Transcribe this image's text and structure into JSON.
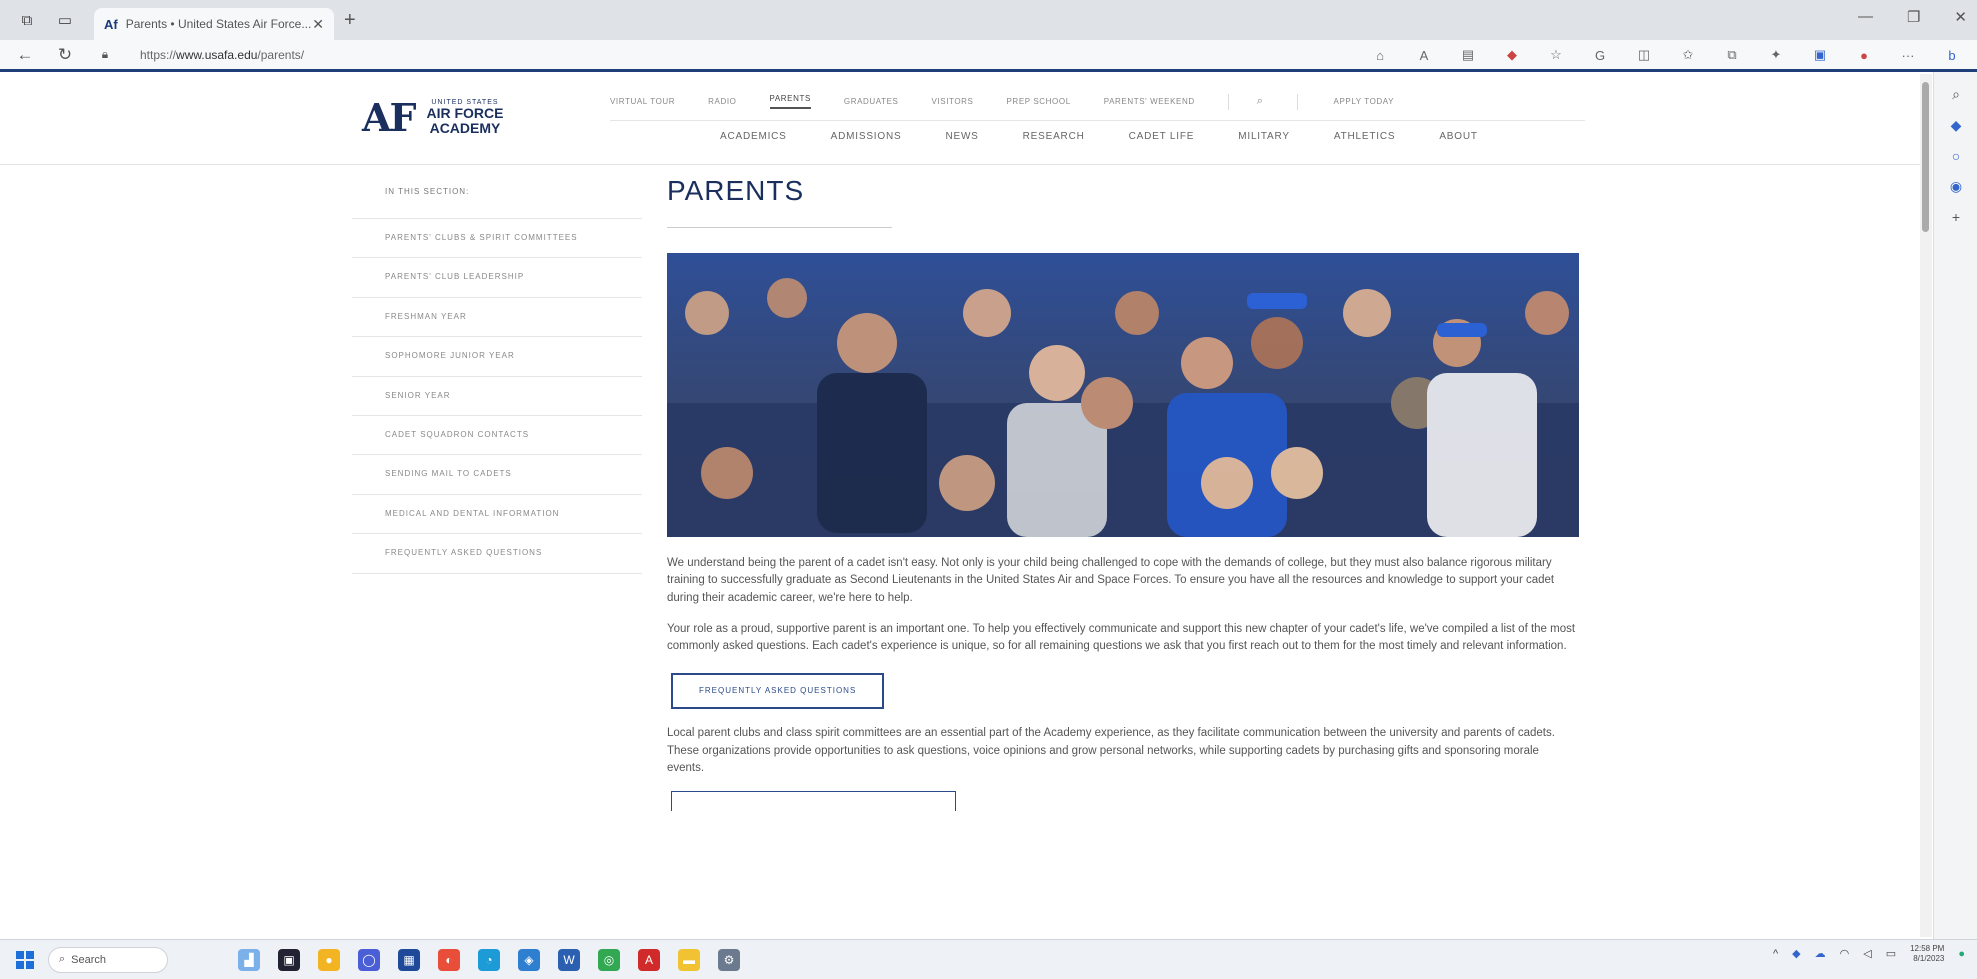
{
  "browser": {
    "tab_title": "Parents • United States Air Force...",
    "tab_favicon": "Af",
    "url_prefix": "https://",
    "url_domain": "www.usafa.edu",
    "url_path": "/parents/"
  },
  "site": {
    "logo": {
      "mark": "AF",
      "line1": "UNITED STATES",
      "line2": "AIR FORCE",
      "line3": "ACADEMY"
    },
    "util_nav": [
      "VIRTUAL TOUR",
      "RADIO",
      "PARENTS",
      "GRADUATES",
      "VISITORS",
      "PREP SCHOOL",
      "PARENTS' WEEKEND"
    ],
    "apply_label": "APPLY TODAY",
    "main_nav": [
      "ACADEMICS",
      "ADMISSIONS",
      "NEWS",
      "RESEARCH",
      "CADET LIFE",
      "MILITARY",
      "ATHLETICS",
      "ABOUT"
    ]
  },
  "section_nav": {
    "heading": "IN THIS SECTION:",
    "items": [
      "PARENTS' CLUBS & SPIRIT COMMITTEES",
      "PARENTS' CLUB LEADERSHIP",
      "FRESHMAN YEAR",
      "SOPHOMORE JUNIOR YEAR",
      "SENIOR YEAR",
      "CADET SQUADRON CONTACTS",
      "SENDING MAIL TO CADETS",
      "MEDICAL AND DENTAL INFORMATION",
      "FREQUENTLY ASKED QUESTIONS"
    ]
  },
  "content": {
    "title": "PARENTS",
    "para1": "We understand being the parent of a cadet isn't easy. Not only is your child being challenged to cope with the demands of college, but they must also balance rigorous military training to successfully graduate as Second Lieutenants in the United States Air and Space Forces. To ensure you have all the resources and knowledge to support your cadet during their academic career, we're here to help.",
    "para2": "Your role as a proud, supportive parent is an important one. To help you effectively communicate and support this new chapter of your cadet's life, we've compiled a list of the most commonly asked questions. Each cadet's experience is unique, so for all remaining questions we ask that you first reach out to them for the most timely and relevant information.",
    "faq_button": "FREQUENTLY ASKED QUESTIONS",
    "para3": "Local parent clubs and class spirit committees are an essential part of the Academy experience, as they facilitate communication between the university and parents of cadets. These organizations provide opportunities to ask questions, voice opinions and grow personal networks, while supporting cadets by purchasing gifts and sponsoring morale events."
  },
  "taskbar": {
    "search_label": "Search",
    "time": "12:58 PM",
    "date": "8/1/2023"
  }
}
